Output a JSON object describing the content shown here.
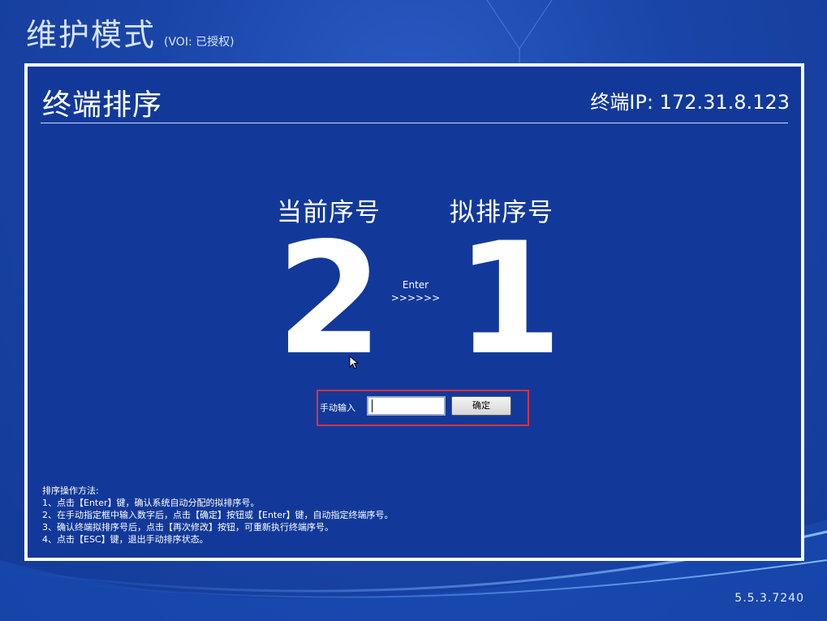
{
  "header": {
    "mode_title": "维护模式",
    "license_status": "(VOI: 已授权)"
  },
  "panel": {
    "title": "终端排序",
    "terminal_ip": "终端IP: 172.31.8.123",
    "current_label": "当前序号",
    "planned_label": "拟排序号",
    "current_number": "2",
    "planned_number": "1",
    "enter_hint": "Enter",
    "arrow_hint": ">>>>>>"
  },
  "manual_input": {
    "label": "手动输入",
    "value": "",
    "confirm_label": "确定"
  },
  "instructions": {
    "heading": "排序操作方法:",
    "lines": [
      "1、点击【Enter】键，确认系统自动分配的拟排序号。",
      "2、在手动指定框中输入数字后，点击【确定】按钮或【Enter】键，自动指定终端序号。",
      "3、确认终端拟排序号后，点击【再次修改】按钮，可重新执行终端序号。",
      "4、点击【ESC】键，退出手动排序状态。"
    ]
  },
  "version": "5.5.3.7240",
  "colors": {
    "background": "#1a45a8",
    "panel": "#12399a",
    "highlight_border": "#e0303a"
  },
  "icons": {
    "cursor": "mouse-pointer-icon"
  }
}
